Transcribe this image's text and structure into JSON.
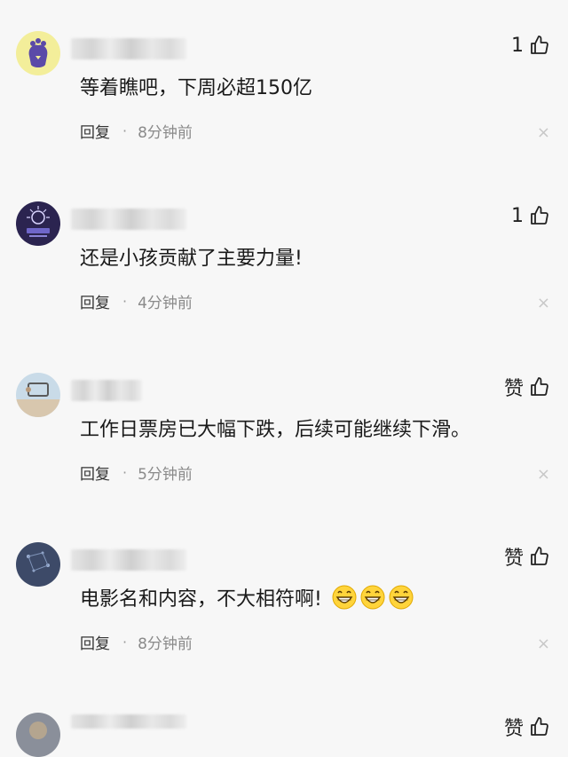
{
  "comments": [
    {
      "like_label": "1",
      "text": "等着瞧吧，下周必超150亿",
      "reply_label": "回复",
      "separator": "·",
      "time": "8分钟前",
      "close_icon": "×",
      "emoji_count": 0
    },
    {
      "like_label": "1",
      "text": "还是小孩贡献了主要力量!",
      "reply_label": "回复",
      "separator": "·",
      "time": "4分钟前",
      "close_icon": "×",
      "emoji_count": 0
    },
    {
      "like_label": "赞",
      "text": "工作日票房已大幅下跌，后续可能继续下滑。",
      "reply_label": "回复",
      "separator": "·",
      "time": "5分钟前",
      "close_icon": "×",
      "emoji_count": 0
    },
    {
      "like_label": "赞",
      "text": "电影名和内容，不大相符啊!",
      "reply_label": "回复",
      "separator": "·",
      "time": "8分钟前",
      "close_icon": "×",
      "emoji_count": 3,
      "emoji_icon": "grinning-face-emoji"
    },
    {
      "like_label": "赞"
    }
  ],
  "colors": {
    "background": "#f7f7f7",
    "text": "#1a1a1a",
    "meta": "#8a8a8a",
    "close": "#c8c8c8"
  }
}
